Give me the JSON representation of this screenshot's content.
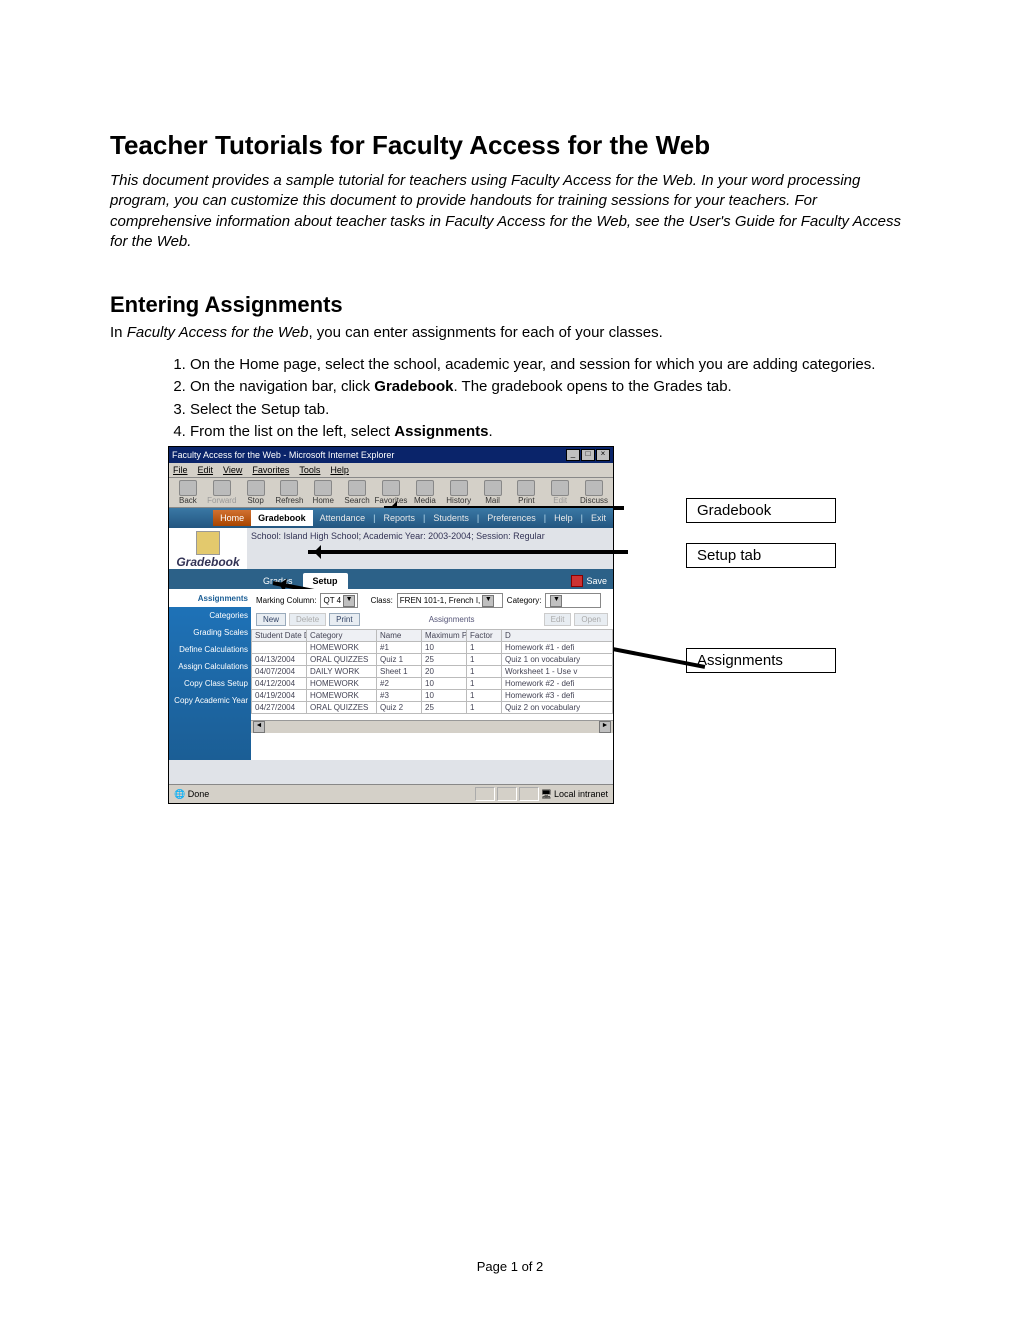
{
  "doc": {
    "h1": "Teacher Tutorials for Faculty Access for the Web",
    "intro": "This document provides a sample tutorial for teachers using Faculty Access for the Web. In your word processing program, you can customize this document to provide handouts for training sessions for your teachers. For comprehensive information about teacher tasks in Faculty Access for the Web, see the User's Guide for Faculty Access for the Web.",
    "h2": "Entering Assignments",
    "lead_pre": "In ",
    "lead_em": "Faculty Access for the Web",
    "lead_post": ", you can enter assignments for each of your classes.",
    "steps": {
      "s1": "On the Home page, select the school, academic year, and session for which you are adding categories.",
      "s2a": "On the navigation bar, click ",
      "s2b": "Gradebook",
      "s2c": ". The gradebook opens to the Grades tab.",
      "s3": "Select the Setup tab.",
      "s4a": "From the list on the left, select ",
      "s4b": "Assignments",
      "s4c": "."
    },
    "footer": "Page 1 of 2"
  },
  "callouts": {
    "c1": "Gradebook",
    "c2": "Setup tab",
    "c3": "Assignments"
  },
  "browser": {
    "title": "Faculty Access for the Web - Microsoft Internet Explorer",
    "menu": [
      "File",
      "Edit",
      "View",
      "Favorites",
      "Tools",
      "Help"
    ],
    "toolbar": [
      "Back",
      "Forward",
      "Stop",
      "Refresh",
      "Home",
      "Search",
      "Favorites",
      "Media",
      "History",
      "Mail",
      "Print",
      "Edit",
      "Discuss"
    ],
    "status_left": "Done",
    "status_right": "Local intranet"
  },
  "app": {
    "nav": [
      "Home",
      "Gradebook",
      "Attendance",
      "Reports",
      "Students",
      "Preferences",
      "Help",
      "Exit"
    ],
    "school_line": "School: Island High School; Academic Year: 2003-2004; Session: Regular",
    "logo_text": "Gradebook",
    "tabs": {
      "t1": "Grades",
      "t2": "Setup"
    },
    "save_btn": "Save",
    "sidebar": [
      "Assignments",
      "Categories",
      "Grading Scales",
      "Define Calculations",
      "Assign Calculations",
      "Copy Class Setup",
      "Copy Academic Year"
    ],
    "controls": {
      "mc_label": "Marking Column:",
      "mc_value": "QT 4",
      "class_label": "Class:",
      "class_value": "FREN 101-1, French I,",
      "cat_label": "Category:",
      "cat_value": ""
    },
    "buttons": {
      "new": "New",
      "delete": "Delete",
      "print": "Print",
      "section": "Assignments",
      "edit": "Edit",
      "open": "Open"
    },
    "grid": {
      "headers": [
        "Student Date Due",
        "Category",
        "Name",
        "Maximum Points",
        "Factor",
        "D"
      ],
      "rows": [
        [
          "",
          "HOMEWORK",
          "#1",
          "10",
          "1",
          "Homework #1 - defi"
        ],
        [
          "04/13/2004",
          "ORAL QUIZZES",
          "Quiz 1",
          "25",
          "1",
          "Quiz 1 on vocabulary"
        ],
        [
          "04/07/2004",
          "DAILY WORK",
          "Sheet 1",
          "20",
          "1",
          "Worksheet 1 - Use v"
        ],
        [
          "04/12/2004",
          "HOMEWORK",
          "#2",
          "10",
          "1",
          "Homework #2 - defi"
        ],
        [
          "04/19/2004",
          "HOMEWORK",
          "#3",
          "10",
          "1",
          "Homework #3 - defi"
        ],
        [
          "04/27/2004",
          "ORAL QUIZZES",
          "Quiz 2",
          "25",
          "1",
          "Quiz 2 on vocabulary"
        ]
      ]
    }
  }
}
